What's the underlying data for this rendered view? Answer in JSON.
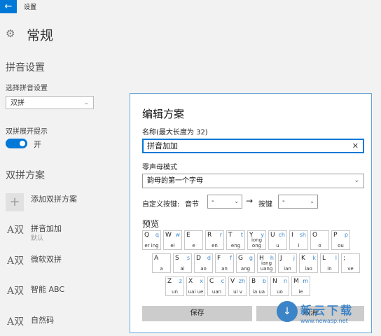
{
  "window": {
    "title": "设置",
    "back_icon": "back-arrow-icon"
  },
  "page": {
    "title": "常规"
  },
  "pinyin": {
    "section": "拼音设置",
    "select_label": "选择拼音设置",
    "selected": "双拼",
    "expand_label": "双拼展开提示",
    "toggle_state": "开"
  },
  "schemes": {
    "section": "双拼方案",
    "add_label": "添加双拼方案",
    "items": [
      {
        "icon": "A双",
        "name": "拼音加加",
        "sub": "默认"
      },
      {
        "icon": "A双",
        "name": "微软双拼",
        "sub": ""
      },
      {
        "icon": "A双",
        "name": "智能 ABC",
        "sub": ""
      },
      {
        "icon": "A双",
        "name": "自然码",
        "sub": ""
      }
    ]
  },
  "dialog": {
    "title": "编辑方案",
    "name_label": "名称(最大长度为 32)",
    "name_value": "拼音加加",
    "zero_label": "零声母模式",
    "zero_value": "韵母的第一个字母",
    "custom_label": "自定义按键:",
    "syllable_label": "音节",
    "syllable_value": "-",
    "key_label": "按键",
    "key_value": "-",
    "preview_label": "预览",
    "save": "保存",
    "cancel": "取消"
  },
  "keyboard": {
    "rows": [
      [
        {
          "k": "Q",
          "s": "q",
          "b": "er ing"
        },
        {
          "k": "W",
          "s": "w",
          "b": "ei"
        },
        {
          "k": "E",
          "s": "",
          "b": "e"
        },
        {
          "k": "R",
          "s": "r",
          "b": "en"
        },
        {
          "k": "T",
          "s": "t",
          "b": "eng"
        },
        {
          "k": "Y",
          "s": "y",
          "b": "iong ong"
        },
        {
          "k": "U",
          "s": "ch",
          "b": "u"
        },
        {
          "k": "I",
          "s": "sh",
          "b": "i"
        },
        {
          "k": "O",
          "s": "",
          "b": "o"
        },
        {
          "k": "P",
          "s": "p",
          "b": "ou"
        }
      ],
      [
        {
          "k": "A",
          "s": "",
          "b": "a"
        },
        {
          "k": "S",
          "s": "s",
          "b": "ai"
        },
        {
          "k": "D",
          "s": "d",
          "b": "ao"
        },
        {
          "k": "F",
          "s": "f",
          "b": "an"
        },
        {
          "k": "G",
          "s": "g",
          "b": "ang"
        },
        {
          "k": "H",
          "s": "h",
          "b": "iang uang"
        },
        {
          "k": "J",
          "s": "j",
          "b": "ian"
        },
        {
          "k": "K",
          "s": "k",
          "b": "iao"
        },
        {
          "k": "L",
          "s": "l",
          "b": "in"
        },
        {
          "k": ";",
          "s": "",
          "b": "ve"
        }
      ],
      [
        {
          "k": "Z",
          "s": "z",
          "b": "un"
        },
        {
          "k": "X",
          "s": "x",
          "b": "uai ue"
        },
        {
          "k": "C",
          "s": "c",
          "b": "uan"
        },
        {
          "k": "V",
          "s": "zh",
          "b": "ui v"
        },
        {
          "k": "B",
          "s": "b",
          "b": "ia ua"
        },
        {
          "k": "N",
          "s": "n",
          "b": "uo"
        },
        {
          "k": "M",
          "s": "m",
          "b": "ie"
        }
      ]
    ]
  },
  "watermark": {
    "name": "新云下载",
    "url": "www.newasp.net"
  },
  "colors": {
    "accent": "#0078d7",
    "watermark": "#3c84c8"
  }
}
